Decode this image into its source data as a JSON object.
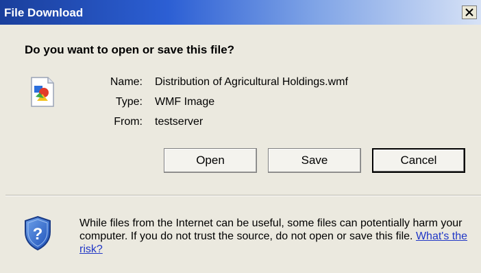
{
  "window": {
    "title": "File Download",
    "close_icon": "close-icon"
  },
  "prompt": {
    "question": "Do you want to open or save this file?"
  },
  "file": {
    "icon": "wmf-file-icon",
    "name_label": "Name:",
    "name_value": "Distribution of Agricultural Holdings.wmf",
    "type_label": "Type:",
    "type_value": "WMF Image",
    "from_label": "From:",
    "from_value": "testserver"
  },
  "buttons": {
    "open": "Open",
    "save": "Save",
    "cancel": "Cancel"
  },
  "warning": {
    "icon": "shield-question-icon",
    "text": "While files from the Internet can be useful, some files can potentially harm your computer. If you do not trust the source, do not open or save this file.",
    "link": "What's the risk?"
  },
  "colors": {
    "title_gradient_start": "#1a3f9c",
    "dialog_bg": "#ebe9df",
    "link": "#1f36c6"
  }
}
